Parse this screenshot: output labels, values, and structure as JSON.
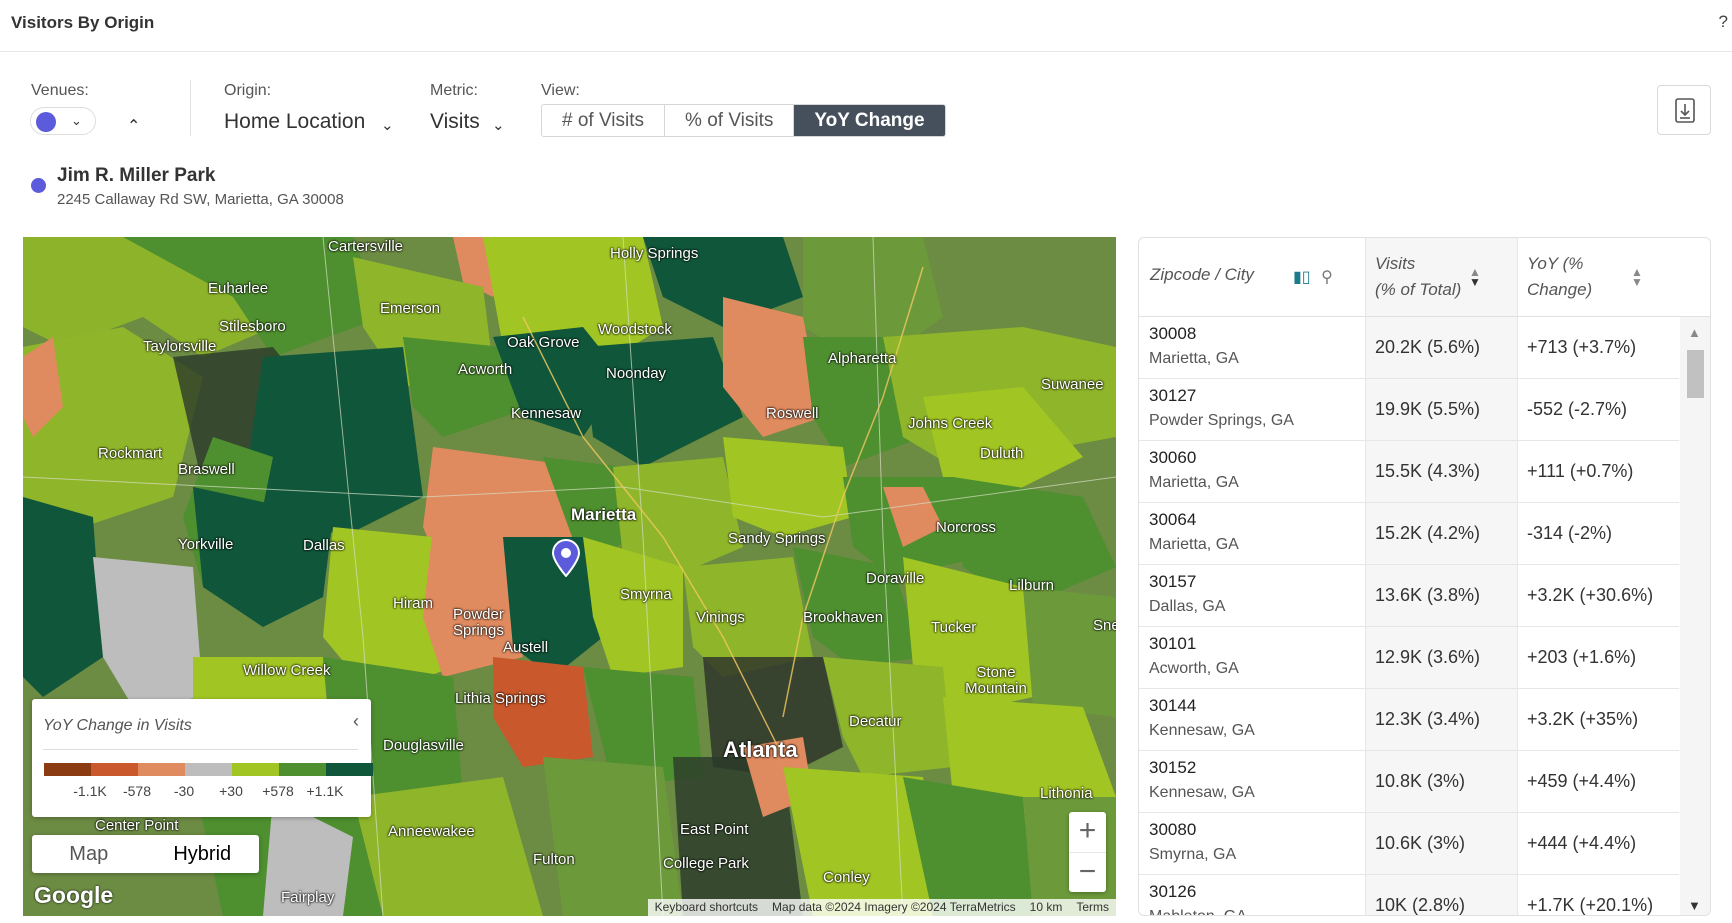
{
  "header": {
    "title": "Visitors By Origin",
    "help": "?"
  },
  "controls": {
    "venues_label": "Venues:",
    "origin_label": "Origin:",
    "origin_value": "Home Location",
    "metric_label": "Metric:",
    "metric_value": "Visits",
    "view_label": "View:",
    "view_options": [
      "# of Visits",
      "% of Visits",
      "YoY Change"
    ],
    "view_selected": "YoY Change",
    "venue_color": "#5b5bdb"
  },
  "venue": {
    "name": "Jim R. Miller Park",
    "address": "2245 Callaway Rd SW, Marietta, GA 30008"
  },
  "map": {
    "labels": [
      "Cartersville",
      "Euharlee",
      "Emerson",
      "Holly Springs",
      "Stilesboro",
      "Taylorsville",
      "Woodstock",
      "Oak Grove",
      "Acworth",
      "Noonday",
      "Alpharetta",
      "Suwanee",
      "Kennesaw",
      "Roswell",
      "Johns Creek",
      "Rockmart",
      "Braswell",
      "Duluth",
      "Marietta",
      "Yorkville",
      "Dallas",
      "Sandy Springs",
      "Norcross",
      "Smyrna",
      "Vinings",
      "Doraville",
      "Lilburn",
      "Hiram",
      "Powder Springs",
      "Brookhaven",
      "Tucker",
      "Willow Creek",
      "Austell",
      "Stone Mountain",
      "Lithia Springs",
      "Decatur",
      "Douglasville",
      "Atlanta",
      "Lithonia",
      "Anneewakee",
      "Center Point",
      "East Point",
      "Fulton",
      "College Park",
      "Conley",
      "Fairplay",
      "Snellville"
    ],
    "legend": {
      "title": "YoY Change in Visits",
      "colors": [
        "#8b3b12",
        "#c9582c",
        "#df8a5f",
        "#bdbdbd",
        "#a1c523",
        "#4e8f2f",
        "#10563a"
      ],
      "ticks": [
        "-1.1K",
        "-578",
        "-30",
        "+30",
        "+578",
        "+1.1K"
      ]
    },
    "map_types": [
      "Map",
      "Hybrid"
    ],
    "map_type_selected": "Hybrid",
    "zoom_in": "+",
    "zoom_out": "−",
    "google": "Google",
    "attribution": [
      "Keyboard shortcuts",
      "Map data ©2024 Imagery ©2024 TerraMetrics",
      "10 km",
      "Terms"
    ]
  },
  "table": {
    "headers": {
      "zip": "Zipcode / City",
      "visits_1": "Visits",
      "visits_2": "(% of Total)",
      "yoy_1": "YoY (%",
      "yoy_2": "Change)"
    },
    "rows": [
      {
        "zip": "30008",
        "city": "Marietta, GA",
        "visits": "20.2K (5.6%)",
        "yoy": "+713 (+3.7%)"
      },
      {
        "zip": "30127",
        "city": "Powder Springs, GA",
        "visits": "19.9K (5.5%)",
        "yoy": "-552 (-2.7%)"
      },
      {
        "zip": "30060",
        "city": "Marietta, GA",
        "visits": "15.5K (4.3%)",
        "yoy": "+111 (+0.7%)"
      },
      {
        "zip": "30064",
        "city": "Marietta, GA",
        "visits": "15.2K (4.2%)",
        "yoy": "-314 (-2%)"
      },
      {
        "zip": "30157",
        "city": "Dallas, GA",
        "visits": "13.6K (3.8%)",
        "yoy": "+3.2K (+30.6%)"
      },
      {
        "zip": "30101",
        "city": "Acworth, GA",
        "visits": "12.9K (3.6%)",
        "yoy": "+203 (+1.6%)"
      },
      {
        "zip": "30144",
        "city": "Kennesaw, GA",
        "visits": "12.3K (3.4%)",
        "yoy": "+3.2K (+35%)"
      },
      {
        "zip": "30152",
        "city": "Kennesaw, GA",
        "visits": "10.8K (3%)",
        "yoy": "+459 (+4.4%)"
      },
      {
        "zip": "30080",
        "city": "Smyrna, GA",
        "visits": "10.6K (3%)",
        "yoy": "+444 (+4.4%)"
      },
      {
        "zip": "30126",
        "city": "Mableton, GA",
        "visits": "10K (2.8%)",
        "yoy": "+1.7K (+20.1%)"
      }
    ]
  }
}
